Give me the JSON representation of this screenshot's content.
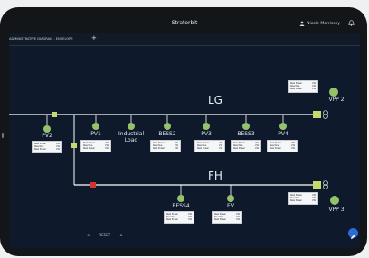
{
  "app": {
    "title": "Stratorbit",
    "user_name": "Nicole Morrissey"
  },
  "tab": {
    "label": "ADMINISTRATIVE DIAGRAM - ENVELOPE",
    "add_label": "+"
  },
  "buses": {
    "lg": "LG",
    "fh": "FH"
  },
  "nodes": {
    "pv2": "PV2",
    "pv1": "PV1",
    "industrial_load": "Industrial Load",
    "bess2": "BESS2",
    "pv3": "PV3",
    "bess3": "BESS3",
    "pv4": "PV4",
    "vpp2": "VPP 2",
    "bess4": "BESS4",
    "ev": "EV",
    "vpp3": "VPP 3"
  },
  "info_rows": {
    "label_1": "Real Power",
    "label_2": "Reactive",
    "label_3": "Real Power",
    "unit_1": "kW",
    "unit_2": "kW",
    "unit_3": "kW"
  },
  "toolbar": {
    "zoom_out": "⊖",
    "reset_label": "RESET",
    "zoom_in": "⊕"
  },
  "colors": {
    "node": "#93c26a",
    "breaker_open": "#d0352f",
    "breaker_closed": "#c5d96d",
    "line": "#ffffff"
  }
}
